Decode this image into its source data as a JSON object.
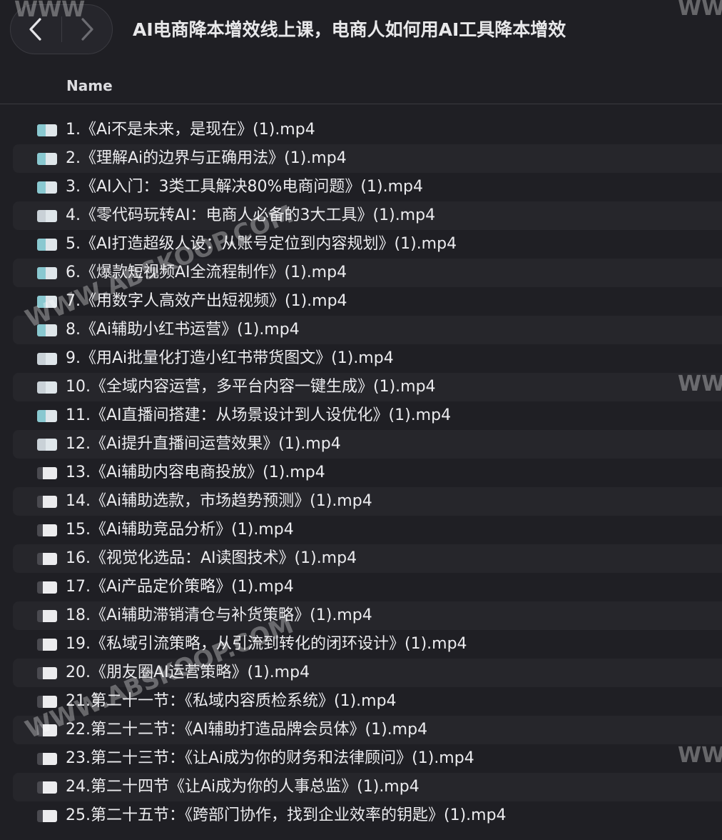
{
  "window": {
    "title": "AI电商降本增效线上课，电商人如何用AI工具降本增效",
    "back_icon": "chevron-left-icon",
    "forward_icon": "chevron-right-icon"
  },
  "table": {
    "column_name": "Name"
  },
  "files": [
    {
      "name": "1.《Ai不是未来，是现在》(1).mp4",
      "icon": "video-thumbnail-icon"
    },
    {
      "name": "2.《理解Ai的边界与正确用法》(1).mp4",
      "icon": "video-thumbnail-icon"
    },
    {
      "name": "3.《AI入门：3类工具解决80%电商问题》(1).mp4",
      "icon": "video-thumbnail-icon"
    },
    {
      "name": "4.《零代码玩转AI：电商人必备的3大工具》(1).mp4",
      "icon": "video-thumbnail-icon"
    },
    {
      "name": "5.《AI打造超级人设：从账号定位到内容规划》(1).mp4",
      "icon": "video-thumbnail-icon"
    },
    {
      "name": "6.《爆款短视频AI全流程制作》(1).mp4",
      "icon": "video-thumbnail-icon"
    },
    {
      "name": "7.《用数字人高效产出短视频》(1).mp4",
      "icon": "video-thumbnail-icon"
    },
    {
      "name": "8.《Ai辅助小红书运营》(1).mp4",
      "icon": "video-thumbnail-icon"
    },
    {
      "name": "9.《用Ai批量化打造小红书带货图文》(1).mp4",
      "icon": "video-thumbnail-icon"
    },
    {
      "name": "10.《全域内容运营，多平台内容一键生成》(1).mp4",
      "icon": "video-thumbnail-icon"
    },
    {
      "name": "11.《AI直播间搭建：从场景设计到人设优化》(1).mp4",
      "icon": "video-thumbnail-icon"
    },
    {
      "name": "12.《Ai提升直播间运营效果》(1).mp4",
      "icon": "video-thumbnail-icon"
    },
    {
      "name": "13.《Ai辅助内容电商投放》(1).mp4",
      "icon": "video-camera-icon"
    },
    {
      "name": "14.《Ai辅助选款，市场趋势预测》(1).mp4",
      "icon": "video-camera-icon"
    },
    {
      "name": "15.《Ai辅助竞品分析》(1).mp4",
      "icon": "video-camera-icon"
    },
    {
      "name": "16.《视觉化选品：AI读图技术》(1).mp4",
      "icon": "video-camera-icon"
    },
    {
      "name": "17.《Ai产品定价策略》(1).mp4",
      "icon": "video-camera-icon"
    },
    {
      "name": "18.《Ai辅助滞销清仓与补货策略》(1).mp4",
      "icon": "video-camera-icon"
    },
    {
      "name": "19.《私域引流策略，从引流到转化的闭环设计》(1).mp4",
      "icon": "video-camera-icon"
    },
    {
      "name": "20.《朋友圈AI运营策略》(1).mp4",
      "icon": "video-camera-icon"
    },
    {
      "name": "21.第二十一节：《私域内容质检系统》(1).mp4",
      "icon": "video-camera-icon"
    },
    {
      "name": "22.第二十二节：《AI辅助打造品牌会员体》(1).mp4",
      "icon": "video-camera-icon"
    },
    {
      "name": "23.第二十三节：《让Ai成为你的财务和法律顾问》(1).mp4",
      "icon": "video-camera-icon"
    },
    {
      "name": "24.第二十四节《让Ai成为你的人事总监》(1).mp4",
      "icon": "video-camera-icon"
    },
    {
      "name": "25.第二十五节：《跨部门协作，找到企业效率的钥匙》(1).mp4",
      "icon": "video-camera-icon"
    }
  ],
  "watermarks": {
    "diagonal": "WWW.ABSKOOP.COM",
    "edge": "WWW"
  },
  "colors": {
    "background": "#1f1f24",
    "row_alt": "#26262b",
    "text": "#ececef"
  }
}
